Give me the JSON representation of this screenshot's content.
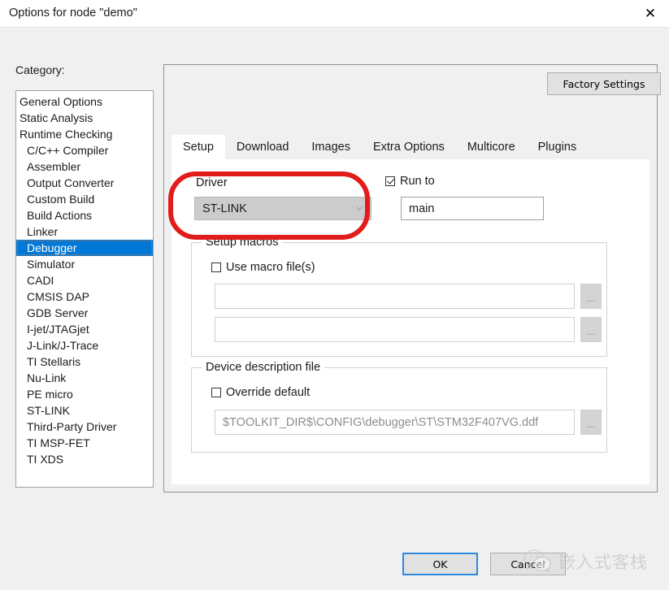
{
  "window": {
    "title": "Options for node \"demo\"",
    "close_icon": "close-icon"
  },
  "sidebar": {
    "label": "Category:",
    "items": [
      {
        "label": "General Options",
        "indent": false,
        "selected": false
      },
      {
        "label": "Static Analysis",
        "indent": false,
        "selected": false
      },
      {
        "label": "Runtime Checking",
        "indent": false,
        "selected": false
      },
      {
        "label": "C/C++ Compiler",
        "indent": true,
        "selected": false
      },
      {
        "label": "Assembler",
        "indent": true,
        "selected": false
      },
      {
        "label": "Output Converter",
        "indent": true,
        "selected": false
      },
      {
        "label": "Custom Build",
        "indent": true,
        "selected": false
      },
      {
        "label": "Build Actions",
        "indent": true,
        "selected": false
      },
      {
        "label": "Linker",
        "indent": true,
        "selected": false
      },
      {
        "label": "Debugger",
        "indent": true,
        "selected": true
      },
      {
        "label": "Simulator",
        "indent": true,
        "selected": false
      },
      {
        "label": "CADI",
        "indent": true,
        "selected": false
      },
      {
        "label": "CMSIS DAP",
        "indent": true,
        "selected": false
      },
      {
        "label": "GDB Server",
        "indent": true,
        "selected": false
      },
      {
        "label": "I-jet/JTAGjet",
        "indent": true,
        "selected": false
      },
      {
        "label": "J-Link/J-Trace",
        "indent": true,
        "selected": false
      },
      {
        "label": "TI Stellaris",
        "indent": true,
        "selected": false
      },
      {
        "label": "Nu-Link",
        "indent": true,
        "selected": false
      },
      {
        "label": "PE micro",
        "indent": true,
        "selected": false
      },
      {
        "label": "ST-LINK",
        "indent": true,
        "selected": false
      },
      {
        "label": "Third-Party Driver",
        "indent": true,
        "selected": false
      },
      {
        "label": "TI MSP-FET",
        "indent": true,
        "selected": false
      },
      {
        "label": "TI XDS",
        "indent": true,
        "selected": false
      }
    ]
  },
  "panel": {
    "factory_settings_label": "Factory Settings",
    "tabs": [
      {
        "label": "Setup",
        "active": true
      },
      {
        "label": "Download",
        "active": false
      },
      {
        "label": "Images",
        "active": false
      },
      {
        "label": "Extra Options",
        "active": false
      },
      {
        "label": "Multicore",
        "active": false
      },
      {
        "label": "Plugins",
        "active": false
      }
    ]
  },
  "setup": {
    "driver_label": "Driver",
    "driver_value": "ST-LINK",
    "driver_chevron": "chevron-down-icon",
    "run_to_label": "Run to",
    "run_to_checked": true,
    "run_to_value": "main",
    "setup_macros": {
      "title": "Setup macros",
      "use_macro_label": "Use macro file(s)",
      "use_macro_checked": false,
      "macro_file_1": "",
      "macro_file_2": "",
      "browse_label": "..."
    },
    "device_description": {
      "title": "Device description file",
      "override_label": "Override default",
      "override_checked": false,
      "path_value": "$TOOLKIT_DIR$\\CONFIG\\debugger\\ST\\STM32F407VG.ddf",
      "browse_label": "..."
    }
  },
  "footer": {
    "ok_label": "OK",
    "cancel_label": "Cancel"
  },
  "watermark": {
    "text": "嵌入式客栈",
    "logo_icon": "wechat-logo-icon"
  },
  "colors": {
    "selection_blue": "#0078d7",
    "annotation_red": "#e21b1b",
    "focus_blue": "#2a8ae0",
    "body_gray": "#f0f0f0"
  }
}
